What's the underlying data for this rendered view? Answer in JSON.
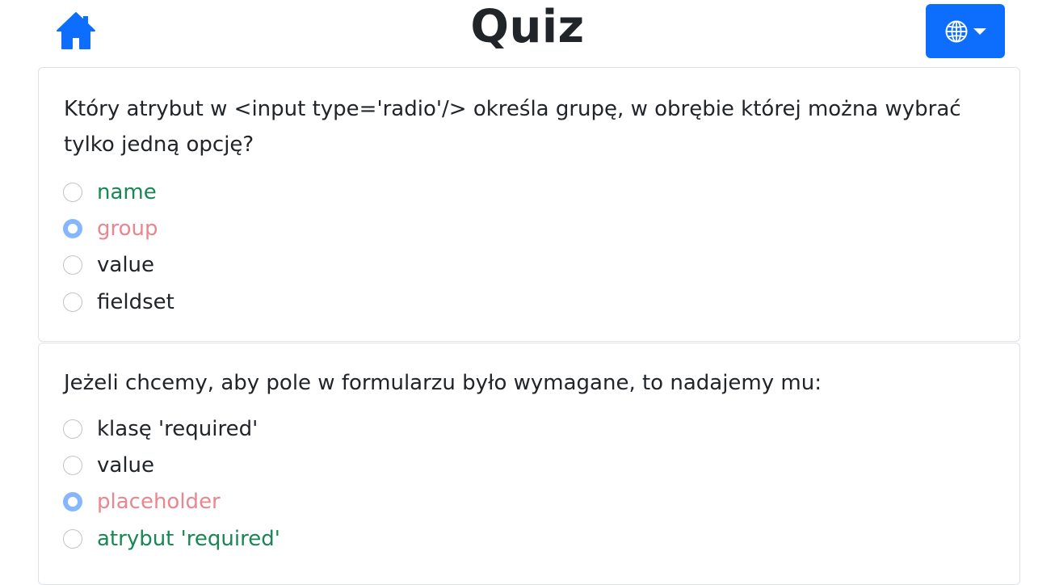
{
  "header": {
    "title": "Quiz",
    "home_icon": "home-icon",
    "language_icon": "globe-icon",
    "accent_color": "#0d6efd"
  },
  "questions": [
    {
      "text": "Który atrybut w <input type='radio'/> określa grupę, w obrębie której można wybrać tylko jedną opcję?",
      "options": [
        {
          "label": "name",
          "state": "correct",
          "selected": false
        },
        {
          "label": "group",
          "state": "wrong",
          "selected": true
        },
        {
          "label": "value",
          "state": "neutral",
          "selected": false
        },
        {
          "label": "fieldset",
          "state": "neutral",
          "selected": false
        }
      ]
    },
    {
      "text": "Jeżeli chcemy, aby pole w formularzu było wymagane, to nadajemy mu:",
      "options": [
        {
          "label": "klasę 'required'",
          "state": "neutral",
          "selected": false
        },
        {
          "label": "value",
          "state": "neutral",
          "selected": false
        },
        {
          "label": "placeholder",
          "state": "wrong",
          "selected": true
        },
        {
          "label": "atrybut 'required'",
          "state": "correct",
          "selected": false
        }
      ]
    }
  ],
  "colors": {
    "correct": "#198754",
    "wrong": "#ea868f",
    "selected_radio": "#86b7fe"
  }
}
